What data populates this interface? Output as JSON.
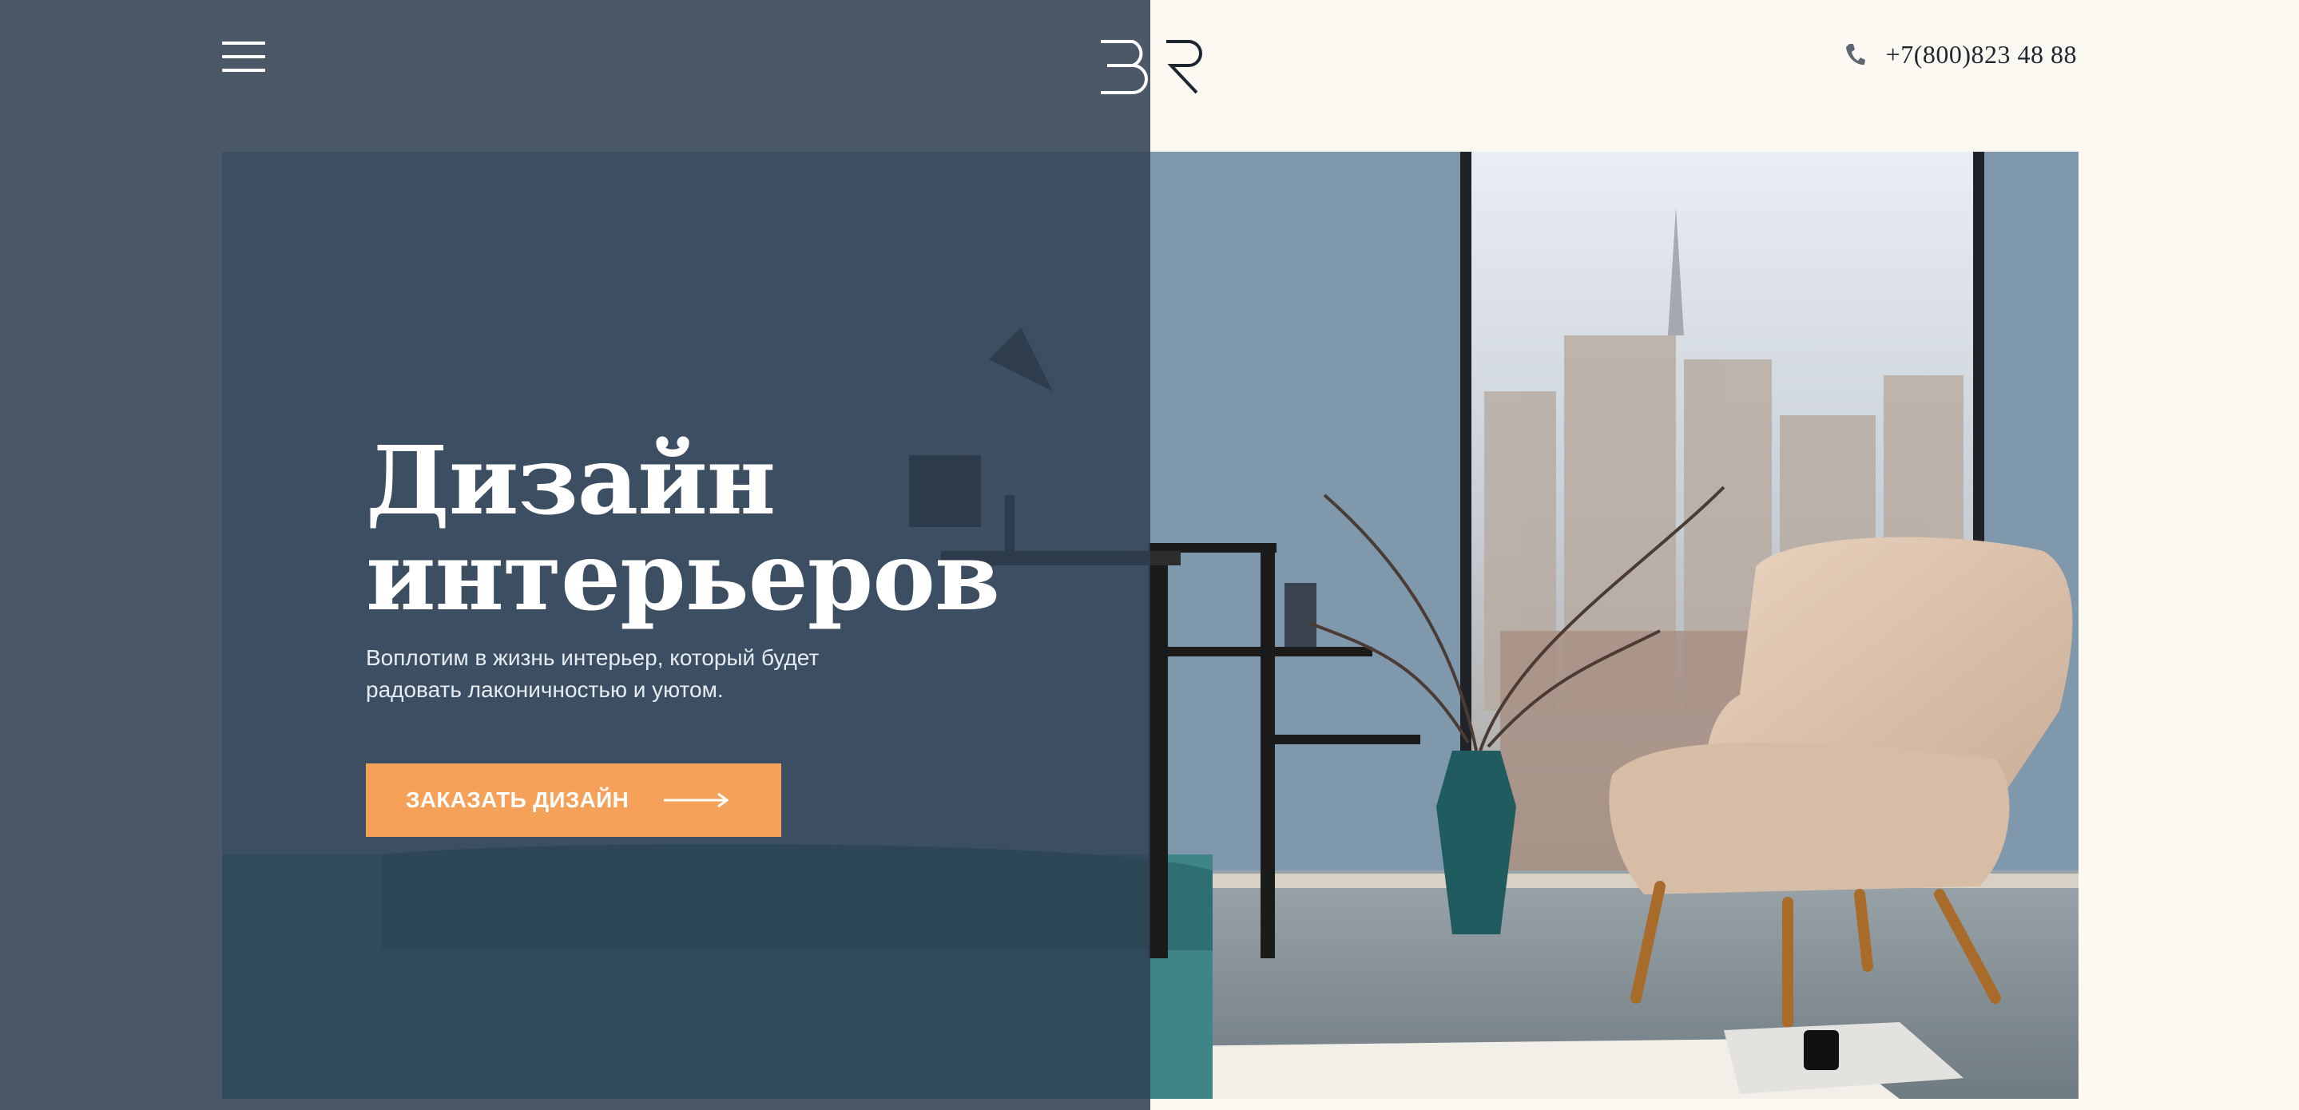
{
  "header": {
    "menu_icon": "hamburger-menu-icon",
    "logo_text": "BR",
    "phone_icon": "phone-icon",
    "phone": "+7(800)823 48 88"
  },
  "hero": {
    "title_line1": "Дизайн",
    "title_line2": "интерьеров",
    "subtitle": "Воплотим в жизнь интерьер, который будет радовать лаконичностью и уютом.",
    "cta_label": "ЗАКАЗАТЬ ДИЗАЙН",
    "cta_icon": "arrow-right-icon"
  },
  "colors": {
    "left_panel": "#4b5867",
    "right_panel": "#fcf9f3",
    "overlay": "#2d3e52",
    "accent": "#f5a15a",
    "wall": "#7f98ab",
    "chair": "#dcc2ab"
  }
}
